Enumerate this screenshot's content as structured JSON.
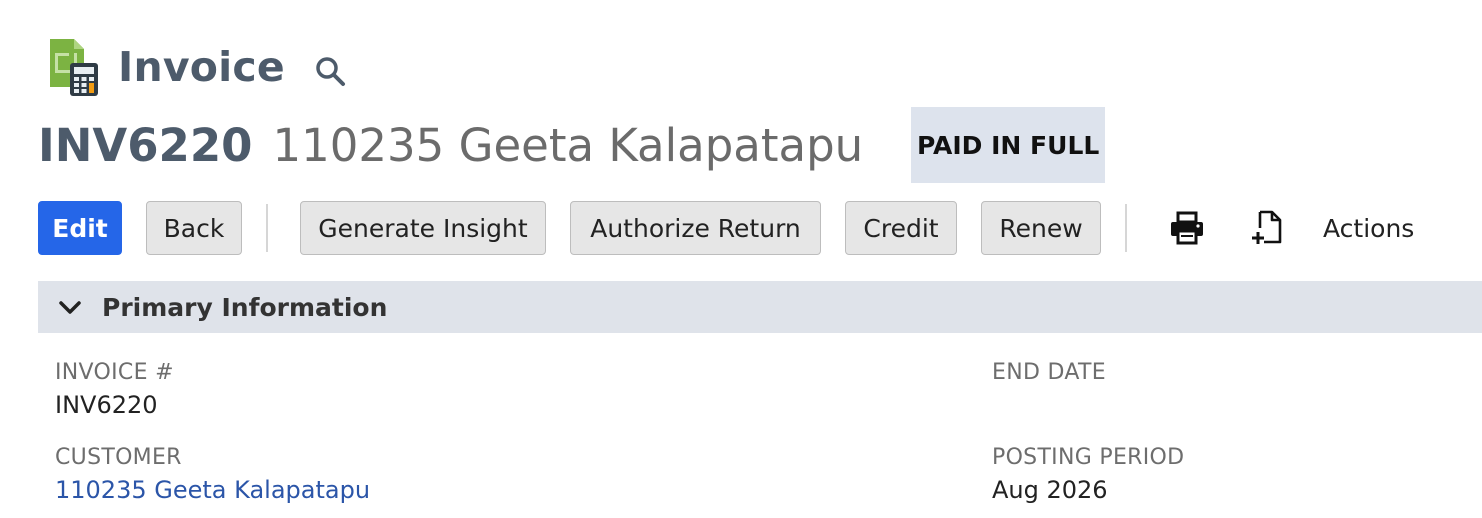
{
  "header": {
    "record_type": "Invoice",
    "record_number": "INV6220",
    "record_name": "110235 Geeta Kalapatapu",
    "status": "PAID IN FULL",
    "icons": {
      "record": "invoice-calculator-icon",
      "search": "search-icon"
    }
  },
  "toolbar": {
    "buttons": [
      {
        "label": "Edit",
        "style": "primary"
      },
      {
        "label": "Back"
      },
      {
        "label": "Generate Insight"
      },
      {
        "label": "Authorize Return"
      },
      {
        "label": "Credit"
      },
      {
        "label": "Renew"
      }
    ],
    "icons": [
      "print-icon",
      "new-document-icon"
    ],
    "actions_label": "Actions"
  },
  "section": {
    "title": "Primary Information",
    "fields": {
      "invoice_number": {
        "label": "INVOICE #",
        "value": "INV6220"
      },
      "customer": {
        "label": "CUSTOMER",
        "value": "110235 Geeta Kalapatapu"
      },
      "end_date": {
        "label": "END DATE",
        "value": ""
      },
      "posting_period": {
        "label": "POSTING PERIOD",
        "value": "Aug 2026"
      }
    }
  },
  "colors": {
    "primary_button": "#2566e8",
    "title_text": "#4d5b6b",
    "badge_bg": "#dde3ed",
    "section_bg": "#dfe3ea",
    "link": "#2b55a8"
  }
}
